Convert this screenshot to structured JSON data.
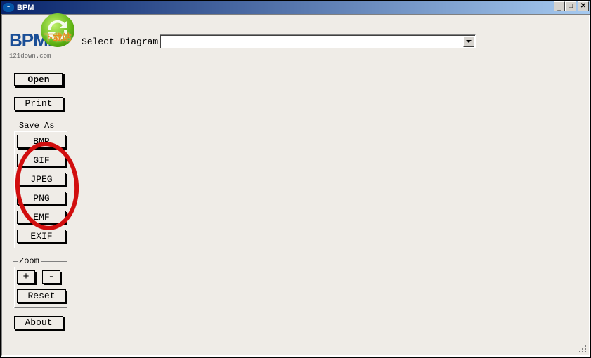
{
  "window": {
    "title": "BPM"
  },
  "titlebar": {
    "min": "_",
    "max": "☐",
    "close": "✕"
  },
  "logo": {
    "text": "BPMN",
    "site": "121down.com"
  },
  "watermark": {
    "text": "下载站"
  },
  "selectRow": {
    "label": "Select Diagram"
  },
  "buttons": {
    "open": "Open",
    "print": "Print",
    "about": "About"
  },
  "saveAs": {
    "legend": "Save As",
    "items": [
      "BMP",
      "GIF",
      "JPEG",
      "PNG",
      "EMF",
      "EXIF"
    ]
  },
  "zoom": {
    "legend": "Zoom",
    "plus": "+",
    "minus": "-",
    "reset": "Reset"
  }
}
